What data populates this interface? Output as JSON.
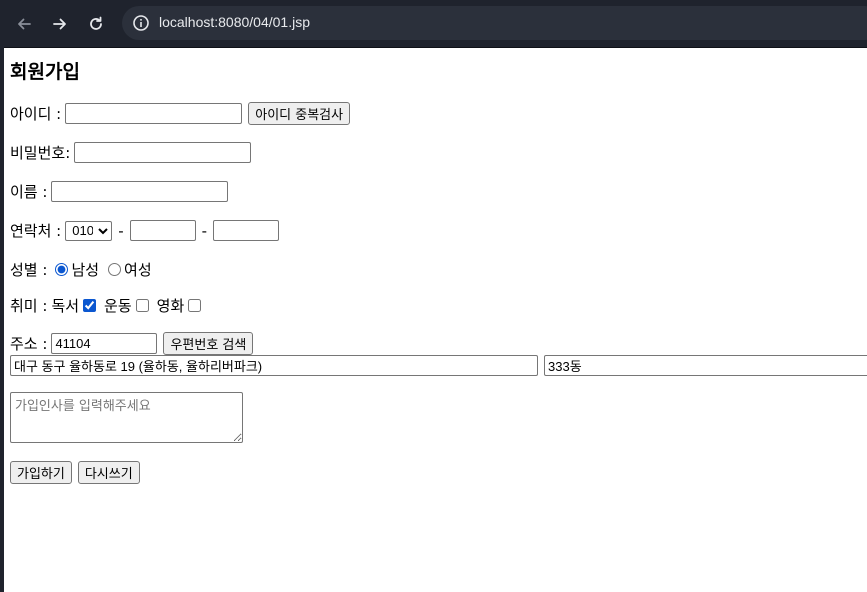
{
  "browser": {
    "url": "localhost:8080/04/01.jsp"
  },
  "form": {
    "title": "회원가입",
    "id": {
      "label": "아이디 :",
      "value": "",
      "check_button": "아이디 중복검사"
    },
    "password": {
      "label": "비밀번호:",
      "value": ""
    },
    "name": {
      "label": "이름 :",
      "value": ""
    },
    "phone": {
      "label": "연락처 :",
      "prefix_selected": "010",
      "prefix_options": [
        "010"
      ],
      "sep1": "-",
      "sep2": "-",
      "middle": "",
      "last": ""
    },
    "gender": {
      "label": "성별 :",
      "options": [
        "남성",
        "여성"
      ],
      "selected": "남성"
    },
    "hobby": {
      "label": "취미 :",
      "items": [
        {
          "label": "독서",
          "checked": true
        },
        {
          "label": "운동",
          "checked": false
        },
        {
          "label": "영화",
          "checked": false
        }
      ]
    },
    "address": {
      "label": "주소 :",
      "zipcode": "41104",
      "search_button": "우편번호 검색",
      "line1": "대구 동구 율하동로 19 (율하동, 율하리버파크)",
      "line2": "333동"
    },
    "greeting": {
      "placeholder": "가입인사를 입력해주세요",
      "value": ""
    },
    "submit_label": "가입하기",
    "reset_label": "다시쓰기"
  }
}
